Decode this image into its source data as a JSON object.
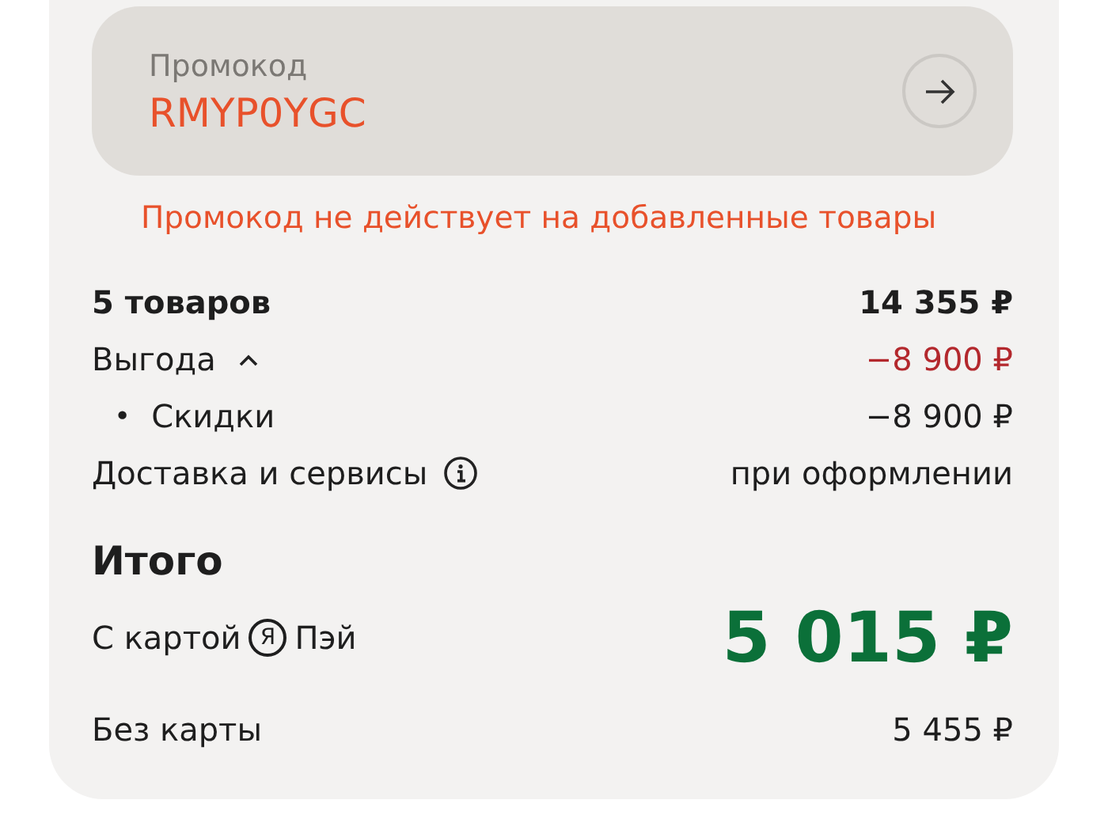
{
  "promo": {
    "label": "Промокод",
    "value": "RMYP0YGC"
  },
  "promo_error": "Промокод не действует на добавленные товары",
  "summary": [
    {
      "kind": "total",
      "label": "5 товаров",
      "value": "14 355 ₽"
    },
    {
      "kind": "benefit",
      "label": "Выгода",
      "value": "−8 900 ₽",
      "expanded": true
    },
    {
      "kind": "sub",
      "bullet": "•",
      "label": "Скидки",
      "value": "−8 900 ₽"
    },
    {
      "kind": "info",
      "label": "Доставка и сервисы",
      "value": "при оформлении"
    }
  ],
  "total": {
    "title": "Итого",
    "card_label_before": "С картой",
    "pay_logo_letter": "Я",
    "card_label_after": "Пэй",
    "card_price": "5 015 ₽",
    "no_card_label": "Без карты",
    "no_card_price": "5 455 ₽"
  }
}
